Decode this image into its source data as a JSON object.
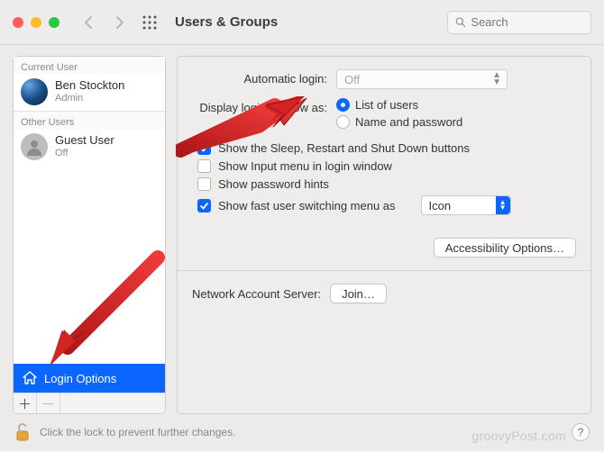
{
  "titlebar": {
    "title": "Users & Groups",
    "search_placeholder": "Search"
  },
  "sidebar": {
    "section_current": "Current User",
    "section_other": "Other Users",
    "current_user_name": "Ben Stockton",
    "current_user_role": "Admin",
    "guest_name": "Guest User",
    "guest_status": "Off",
    "login_options": "Login Options"
  },
  "main": {
    "auto_login_label": "Automatic login:",
    "auto_login_value": "Off",
    "display_login_label": "Display login window as:",
    "radio_list": "List of users",
    "radio_namepw": "Name and password",
    "chk_sleep": "Show the Sleep, Restart and Shut Down buttons",
    "chk_input": "Show Input menu in login window",
    "chk_hints": "Show password hints",
    "chk_fastswitch": "Show fast user switching menu as",
    "fastswitch_value": "Icon",
    "accessibility_btn": "Accessibility Options…",
    "network_label": "Network Account Server:",
    "join_btn": "Join…"
  },
  "footer": {
    "lock_text": "Click the lock to prevent further changes.",
    "brand": "groovyPost.com"
  }
}
